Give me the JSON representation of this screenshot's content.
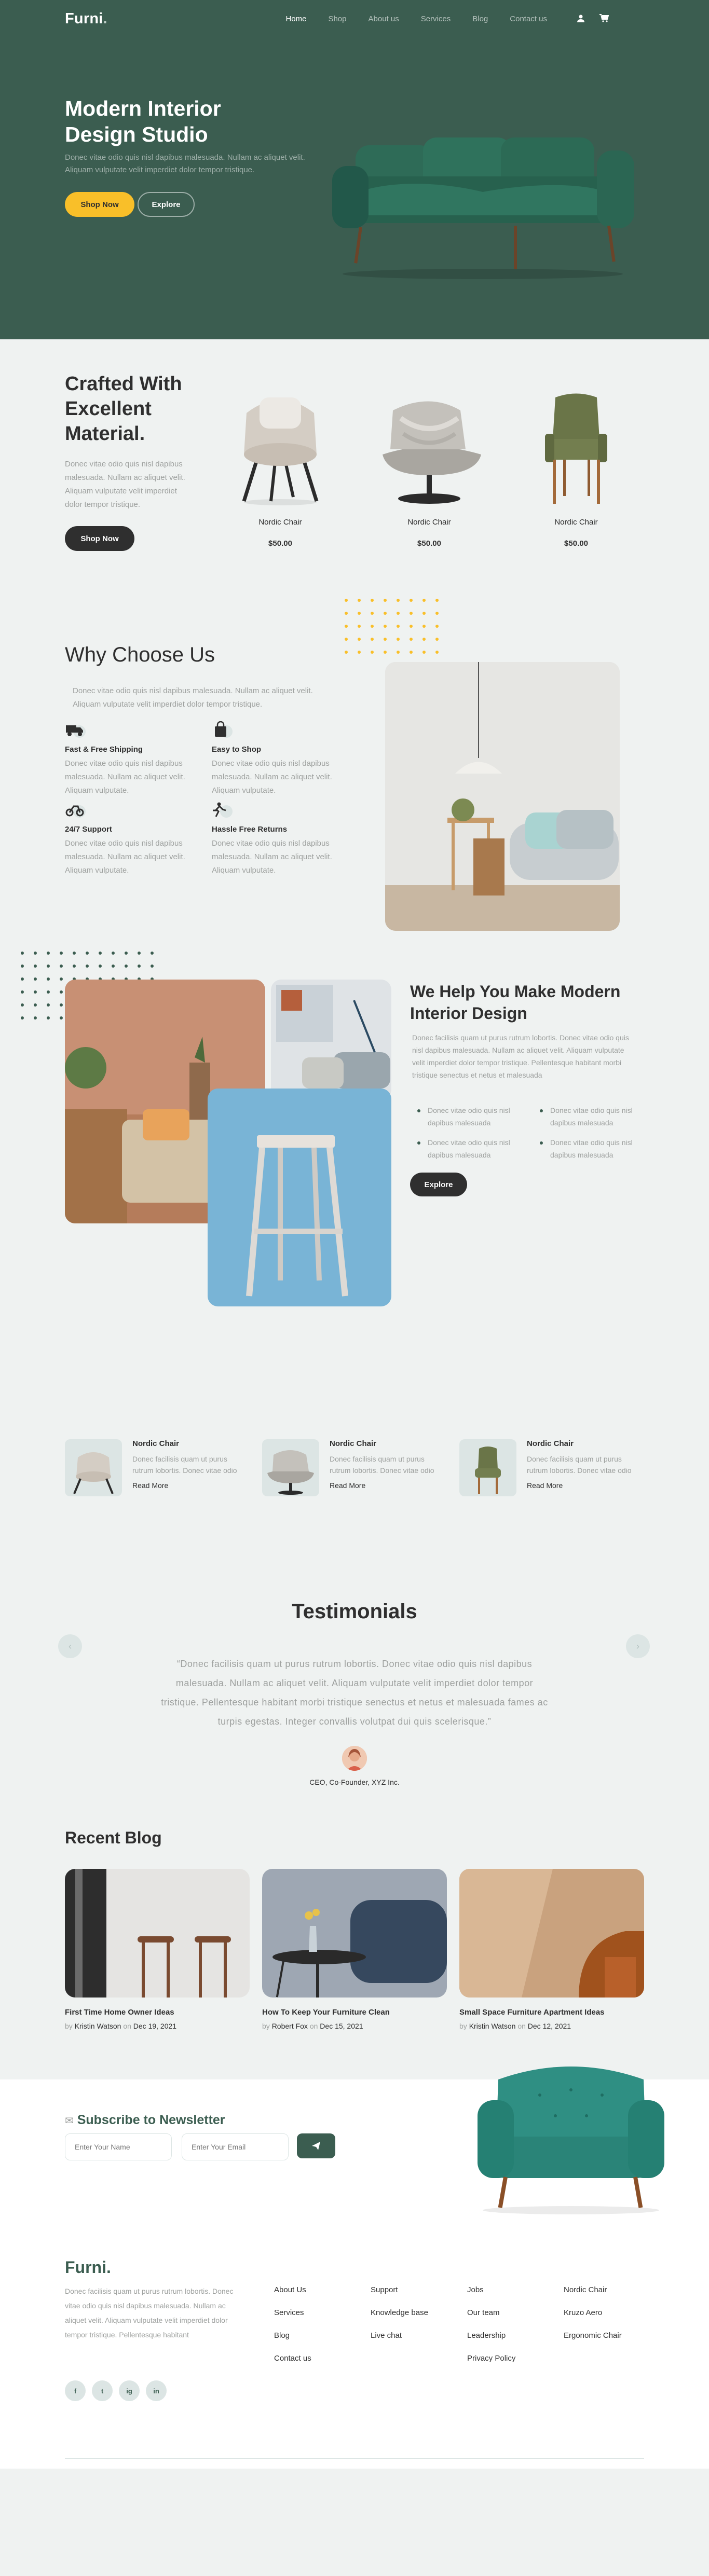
{
  "brand": {
    "name": "Furni",
    "dot": ".",
    "primary": "#3b5d50",
    "accent": "#f9bf29",
    "dark": "#2f2f2f"
  },
  "nav": {
    "items": [
      "Home",
      "Shop",
      "About us",
      "Services",
      "Blog",
      "Contact us"
    ],
    "icons": [
      "user-icon",
      "cart-icon"
    ]
  },
  "hero": {
    "title_line1": "Modern Interior",
    "title_line2": "Design Studio",
    "text": "Donec vitae odio quis nisl dapibus malesuada. Nullam ac aliquet velit. Aliquam vulputate velit imperdiet dolor tempor tristique.",
    "btn_primary": "Shop Now",
    "btn_secondary": "Explore"
  },
  "products": {
    "title_line1": "Crafted With",
    "title_line2": "Excellent",
    "title_line3": "Material.",
    "text": "Donec vitae odio quis nisl dapibus malesuada. Nullam ac aliquet velit. Aliquam vulputate velit imperdiet dolor tempor tristique.",
    "button": "Shop Now",
    "items": [
      {
        "name": "Nordic Chair",
        "price": "$50.00"
      },
      {
        "name": "Nordic Chair",
        "price": "$50.00"
      },
      {
        "name": "Nordic Chair",
        "price": "$50.00"
      }
    ]
  },
  "why": {
    "title": "Why Choose Us",
    "text": "Donec vitae odio quis nisl dapibus malesuada. Nullam ac aliquet velit. Aliquam vulputate velit imperdiet dolor tempor tristique.",
    "features": [
      {
        "title": "Fast & Free Shipping",
        "text": "Donec vitae odio quis nisl dapibus malesuada. Nullam ac aliquet velit. Aliquam vulputate.",
        "icon": "truck-icon"
      },
      {
        "title": "Easy to Shop",
        "text": "Donec vitae odio quis nisl dapibus malesuada. Nullam ac aliquet velit. Aliquam vulputate.",
        "icon": "bag-icon"
      },
      {
        "title": "24/7 Support",
        "text": "Donec vitae odio quis nisl dapibus malesuada. Nullam ac aliquet velit. Aliquam vulputate.",
        "icon": "support-icon"
      },
      {
        "title": "Hassle Free Returns",
        "text": "Donec vitae odio quis nisl dapibus malesuada. Nullam ac aliquet velit. Aliquam vulputate.",
        "icon": "return-icon"
      }
    ]
  },
  "help": {
    "title_line1": "We Help You Make Modern",
    "title_line2": "Interior Design",
    "text": "Donec facilisis quam ut purus rutrum lobortis. Donec vitae odio quis nisl dapibus malesuada. Nullam ac aliquet velit. Aliquam vulputate velit imperdiet dolor tempor tristique. Pellentesque habitant morbi tristique senectus et netus et malesuada",
    "bullets": [
      "Donec vitae odio quis nisl dapibus malesuada",
      "Donec vitae odio quis nisl dapibus malesuada",
      "Donec vitae odio quis nisl dapibus malesuada",
      "Donec vitae odio quis nisl dapibus malesuada"
    ],
    "button": "Explore"
  },
  "mini_products": [
    {
      "name": "Nordic Chair",
      "text": "Donec facilisis quam ut purus rutrum lobortis. Donec vitae odio",
      "link": "Read More"
    },
    {
      "name": "Nordic Chair",
      "text": "Donec facilisis quam ut purus rutrum lobortis. Donec vitae odio",
      "link": "Read More"
    },
    {
      "name": "Nordic Chair",
      "text": "Donec facilisis quam ut purus rutrum lobortis. Donec vitae odio",
      "link": "Read More"
    }
  ],
  "testimonials": {
    "title": "Testimonials",
    "quote": "“Donec facilisis quam ut purus rutrum lobortis. Donec vitae odio quis nisl dapibus malesuada. Nullam ac aliquet velit. Aliquam vulputate velit imperdiet dolor tempor tristique. Pellentesque habitant morbi tristique senectus et netus et malesuada fames ac turpis egestas. Integer convallis volutpat dui quis scelerisque.”",
    "author": "CEO, Co-Founder, XYZ Inc.",
    "prev": "‹",
    "next": "›"
  },
  "blog": {
    "title": "Recent Blog",
    "posts": [
      {
        "title": "First Time Home Owner Ideas",
        "by": "by",
        "author": "Kristin Watson",
        "on": "on",
        "date": "Dec 19, 2021"
      },
      {
        "title": "How To Keep Your Furniture Clean",
        "by": "by",
        "author": "Robert Fox",
        "on": "on",
        "date": "Dec 15, 2021"
      },
      {
        "title": "Small Space Furniture Apartment Ideas",
        "by": "by",
        "author": "Kristin Watson",
        "on": "on",
        "date": "Dec 12, 2021"
      }
    ]
  },
  "newsletter": {
    "title": "Subscribe to Newsletter",
    "name_placeholder": "Enter Your Name",
    "email_placeholder": "Enter Your Email"
  },
  "footer": {
    "logo": "Furni.",
    "about": "Donec facilisis quam ut purus rutrum lobortis. Donec vitae odio quis nisl dapibus malesuada. Nullam ac aliquet velit. Aliquam vulputate velit imperdiet dolor tempor tristique. Pellentesque habitant",
    "socials": [
      "f",
      "t",
      "ig",
      "in"
    ],
    "col1": [
      "About Us",
      "Services",
      "Blog",
      "Contact us"
    ],
    "col2": [
      "Support",
      "Knowledge base",
      "Live chat"
    ],
    "col3": [
      "Jobs",
      "Our team",
      "Leadership",
      "Privacy Policy"
    ],
    "col4": [
      "Nordic Chair",
      "Kruzo Aero",
      "Ergonomic Chair"
    ]
  }
}
